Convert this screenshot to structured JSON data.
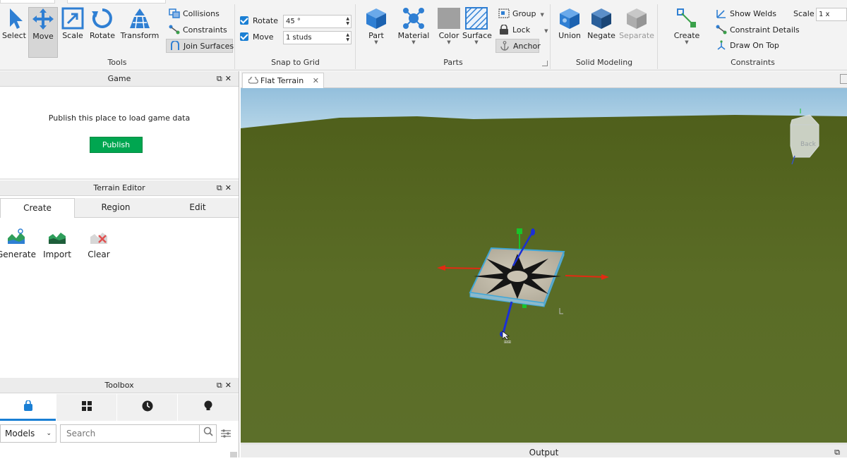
{
  "ribbon": {
    "tools": {
      "label": "Tools",
      "select": "Select",
      "move": "Move",
      "scale": "Scale",
      "rotate": "Rotate",
      "transform": "Transform",
      "collisions": "Collisions",
      "constraints": "Constraints",
      "join_surfaces": "Join Surfaces"
    },
    "snap": {
      "label": "Snap to Grid",
      "rotate_label": "Rotate",
      "rotate_value": "45 °",
      "move_label": "Move",
      "move_value": "1 studs"
    },
    "parts": {
      "label": "Parts",
      "part": "Part",
      "material": "Material",
      "color": "Color",
      "surface": "Surface",
      "group": "Group",
      "lock": "Lock",
      "anchor": "Anchor"
    },
    "solid": {
      "label": "Solid Modeling",
      "union": "Union",
      "negate": "Negate",
      "separate": "Separate"
    },
    "constraints": {
      "label": "Constraints",
      "create": "Create",
      "show_welds": "Show Welds",
      "constraint_details": "Constraint Details",
      "draw_on_top": "Draw On Top",
      "scale_label": "Scale",
      "scale_value": "1 x"
    }
  },
  "game_panel": {
    "title": "Game",
    "message": "Publish this place to load game data",
    "publish_button": "Publish"
  },
  "terrain_editor": {
    "title": "Terrain Editor",
    "tabs": [
      "Create",
      "Region",
      "Edit"
    ],
    "tools": [
      "Generate",
      "Import",
      "Clear"
    ]
  },
  "toolbox": {
    "title": "Toolbox",
    "category": "Models",
    "search_placeholder": "Search"
  },
  "viewport": {
    "tab_title": "Flat Terrain",
    "view_cube_label": "Back"
  },
  "output": {
    "title": "Output"
  },
  "colors": {
    "accent_blue": "#1a7fd4",
    "publish_green": "#00a650",
    "grass": "#556b22",
    "sky": "#a3c8e0"
  }
}
